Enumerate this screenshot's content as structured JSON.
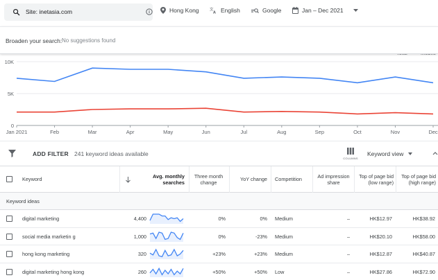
{
  "search": {
    "text": "Site: inetasia.com"
  },
  "filters": {
    "location": "Hong Kong",
    "language": "English",
    "network": "Google",
    "date_range": "Jan – Dec 2021"
  },
  "broaden": {
    "label": "Broaden your search:",
    "value": "No suggestions found"
  },
  "chart_data": {
    "type": "line",
    "x": [
      "Jan 2021",
      "Feb",
      "Mar",
      "Apr",
      "May",
      "Jun",
      "Jul",
      "Aug",
      "Sep",
      "Oct",
      "Nov",
      "Dec"
    ],
    "y_ticks": [
      "10K",
      "5K",
      "0"
    ],
    "ylim": [
      0,
      10000
    ],
    "series": [
      {
        "name": "Total",
        "color": "#4285f4",
        "values": [
          7400,
          6900,
          9000,
          8800,
          8800,
          8400,
          7400,
          7600,
          7400,
          6700,
          7600,
          6700
        ]
      },
      {
        "name": "Mobile",
        "color": "#ea4335",
        "values": [
          2100,
          2100,
          2500,
          2600,
          2600,
          2700,
          2100,
          2200,
          2100,
          1800,
          2000,
          1800
        ]
      }
    ]
  },
  "toolbar": {
    "add_filter": "ADD FILTER",
    "count": "241 keyword ideas available",
    "columns_caption": "COLUMNS",
    "view": "Keyword view"
  },
  "table": {
    "headers": {
      "keyword": "Keyword",
      "avg_monthly": "Avg. monthly searches",
      "three_month": "Three month change",
      "yoy": "YoY change",
      "competition": "Competition",
      "ad_share": "Ad impression share",
      "bid_low": "Top of page bid (low range)",
      "bid_high": "Top of page bid (high range)"
    },
    "section": "Keyword ideas",
    "rows": [
      {
        "keyword": "digital marketing",
        "avg": "4,400",
        "three": "0%",
        "yoy": "0%",
        "competition": "Medium",
        "share": "–",
        "low": "HK$12.97",
        "high": "HK$38.92",
        "trend": [
          3,
          10,
          10,
          10,
          8,
          8,
          4,
          6,
          5,
          6,
          2,
          5
        ]
      },
      {
        "keyword": "social media marketin g",
        "avg": "1,000",
        "three": "0%",
        "yoy": "-23%",
        "competition": "Medium",
        "share": "–",
        "low": "HK$20.10",
        "high": "HK$58.00",
        "trend": [
          8,
          9,
          3,
          10,
          9,
          2,
          3,
          10,
          9,
          4,
          2,
          9
        ]
      },
      {
        "keyword": "hong kong marketing",
        "avg": "320",
        "three": "+23%",
        "yoy": "+23%",
        "competition": "Medium",
        "share": "–",
        "low": "HK$12.87",
        "high": "HK$40.87",
        "trend": [
          6,
          4,
          10,
          3,
          2,
          9,
          3,
          4,
          10,
          3,
          5,
          9
        ]
      },
      {
        "keyword": "digital marketing hong kong",
        "avg": "260",
        "three": "+50%",
        "yoy": "+50%",
        "competition": "Low",
        "share": "–",
        "low": "HK$27.86",
        "high": "HK$72.90",
        "trend": [
          4,
          8,
          3,
          9,
          2,
          7,
          3,
          8,
          2,
          6,
          3,
          9
        ]
      }
    ]
  }
}
